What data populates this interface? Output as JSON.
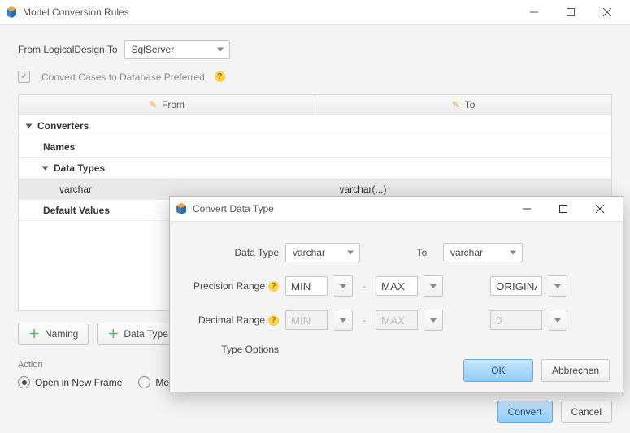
{
  "main": {
    "title": "Model Conversion Rules",
    "from_label": "From LogicalDesign To",
    "target_db": "SqlServer",
    "convert_cases_label": "Convert Cases to Database Preferred",
    "convert_cases_checked": true,
    "grid": {
      "col_from": "From",
      "col_to": "To",
      "rows": {
        "converters": "Converters",
        "names": "Names",
        "datatypes": "Data Types",
        "varchar_from": "varchar",
        "varchar_to": "varchar(...)",
        "defaults": "Default Values"
      }
    },
    "toolbar": {
      "naming": "Naming",
      "datatype": "Data Type"
    },
    "action": {
      "label": "Action",
      "open_frame": "Open in New Frame",
      "merge": "Me"
    },
    "footer": {
      "convert": "Convert",
      "cancel": "Cancel"
    }
  },
  "dialog": {
    "title": "Convert Data Type",
    "dtype_label": "Data Type",
    "dtype_from": "varchar",
    "to_label": "To",
    "dtype_to": "varchar",
    "prec_label": "Precision Range",
    "prec_min": "MIN",
    "prec_max": "MAX",
    "prec_result": "ORIGINAL",
    "dec_label": "Decimal Range",
    "dec_min": "MIN",
    "dec_max": "MAX",
    "dec_result": "0",
    "opts_label": "Type Options",
    "ok": "OK",
    "cancel": "Abbrechen"
  }
}
